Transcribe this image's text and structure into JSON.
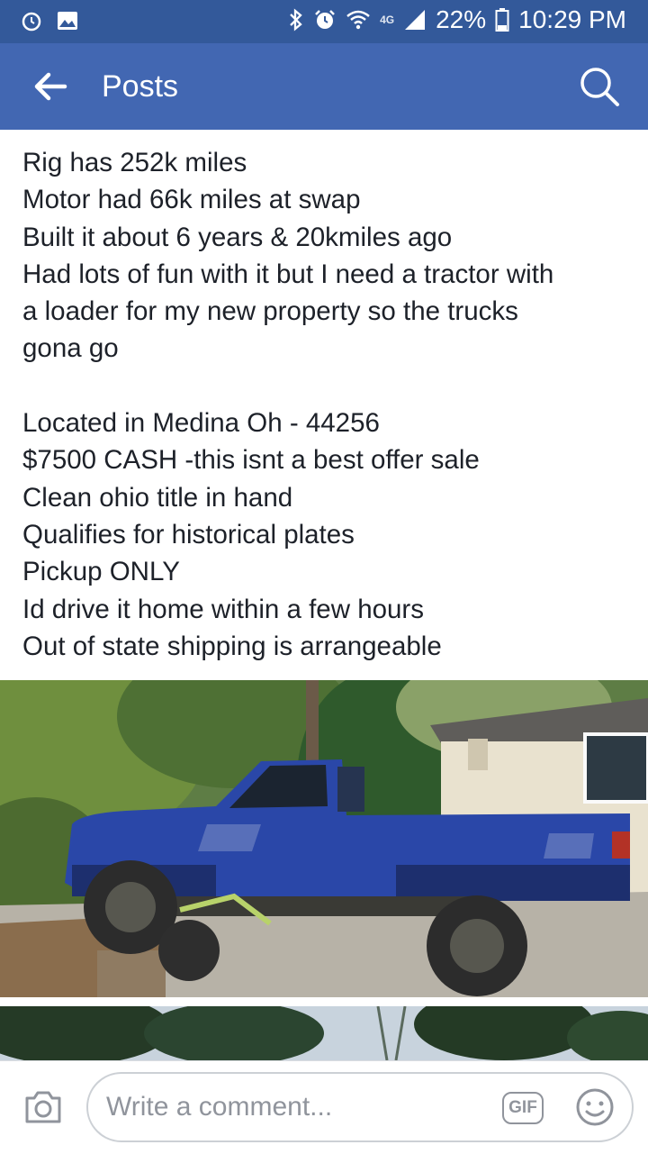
{
  "status_bar": {
    "network": "4G",
    "battery": "22%",
    "time": "10:29 PM"
  },
  "header": {
    "title": "Posts"
  },
  "post": {
    "lines": [
      "Rig has 252k miles",
      "Motor had 66k miles at swap",
      "Built it about 6 years & 20kmiles ago",
      "Had lots of fun with it but I need a tractor with",
      "a loader for my new property so the trucks",
      "gona go",
      "",
      "Located in Medina Oh - 44256",
      "$7500 CASH -this isnt a best offer sale",
      "Clean ohio title in hand",
      "Qualifies for historical plates",
      "Pickup ONLY",
      "Id drive it home within a few hours",
      "Out of state shipping is arrangeable"
    ]
  },
  "comment_bar": {
    "placeholder": "Write a comment...",
    "gif_label": "GIF"
  },
  "icons": {
    "back": "arrow-left-icon",
    "search": "search-icon",
    "camera": "camera-icon",
    "emoji": "smiley-icon"
  },
  "colors": {
    "status_bar": "#33599a",
    "app_bar": "#4267b2",
    "text": "#1d2129",
    "muted": "#90949c",
    "truck_blue": "#2a47a8"
  }
}
